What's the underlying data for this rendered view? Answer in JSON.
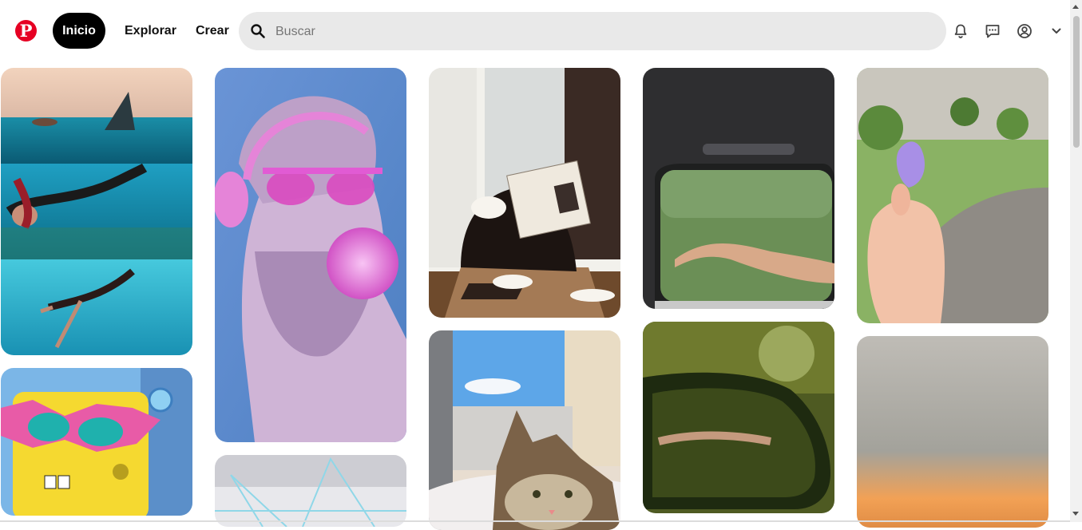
{
  "app": {
    "logo_letter": "P",
    "brand_color": "#e60023"
  },
  "nav": {
    "home_label": "Inicio",
    "explore_label": "Explorar",
    "create_label": "Crear"
  },
  "search": {
    "placeholder": "Buscar",
    "value": ""
  },
  "header_icons": [
    "bell-icon",
    "message-icon",
    "account-icon",
    "chevron-down-icon"
  ],
  "pins": [
    {
      "name": "pin-swimmers-shark",
      "colors": [
        "#f2d3bd",
        "#0e7d98",
        "#137f9e",
        "#22b6cf"
      ]
    },
    {
      "name": "pin-spongebob-sunglasses",
      "colors": [
        "#7bb6e7",
        "#f5d930",
        "#e85ba7"
      ]
    },
    {
      "name": "pin-statue-headphones-bubblegum",
      "colors": [
        "#5f8fcf",
        "#cfb4d6",
        "#e06ad3"
      ]
    },
    {
      "name": "pin-geometry-sketch",
      "colors": [
        "#e8e8ec",
        "#8fd7e8"
      ]
    },
    {
      "name": "pin-woman-reading-cafe",
      "colors": [
        "#f2f1ec",
        "#1c1411",
        "#6e4a2c"
      ]
    },
    {
      "name": "pin-cat-window",
      "colors": [
        "#5da6e8",
        "#e8ddd0",
        "#7b6248"
      ]
    },
    {
      "name": "pin-car-window-hand",
      "colors": [
        "#2e2e30",
        "#6b8f56",
        "#d8a989"
      ]
    },
    {
      "name": "pin-side-mirror-forest",
      "colors": [
        "#4e5a22",
        "#1e2a10",
        "#9ca85d"
      ]
    },
    {
      "name": "pin-hand-purple-candy",
      "colors": [
        "#8ab264",
        "#f2c2a8",
        "#a88fe6"
      ]
    },
    {
      "name": "pin-sunset-sky",
      "colors": [
        "#bfbcb6",
        "#a3a29b",
        "#f2a155"
      ]
    }
  ]
}
